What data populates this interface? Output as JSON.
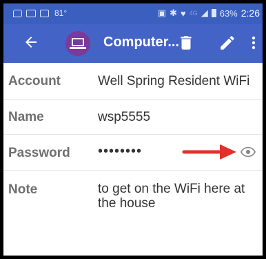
{
  "status_bar": {
    "temperature": "81°",
    "network": "4G",
    "battery": "63%",
    "time": "2:26",
    "icons": [
      "message-icon",
      "image-icon",
      "photo-icon",
      "nfc-icon",
      "bluetooth-icon",
      "wifi-icon",
      "signal-icon",
      "battery-icon"
    ]
  },
  "app_bar": {
    "title": "Computer...",
    "icons": [
      "back-arrow-icon",
      "laptop-icon",
      "trash-icon",
      "pencil-icon",
      "more-vert-icon"
    ],
    "background": "#4463c6",
    "avatar_color": "#7a3a9c"
  },
  "fields": {
    "account": {
      "label": "Account",
      "value": "Well Spring Resident WiFi"
    },
    "name": {
      "label": "Name",
      "value": "wsp5555"
    },
    "password": {
      "label": "Password",
      "value": "••••••••"
    },
    "note": {
      "label": "Note",
      "value": "to get on the WiFi here at the house"
    }
  },
  "annotation": {
    "arrow_color": "#e0322a",
    "target": "eye-icon"
  }
}
